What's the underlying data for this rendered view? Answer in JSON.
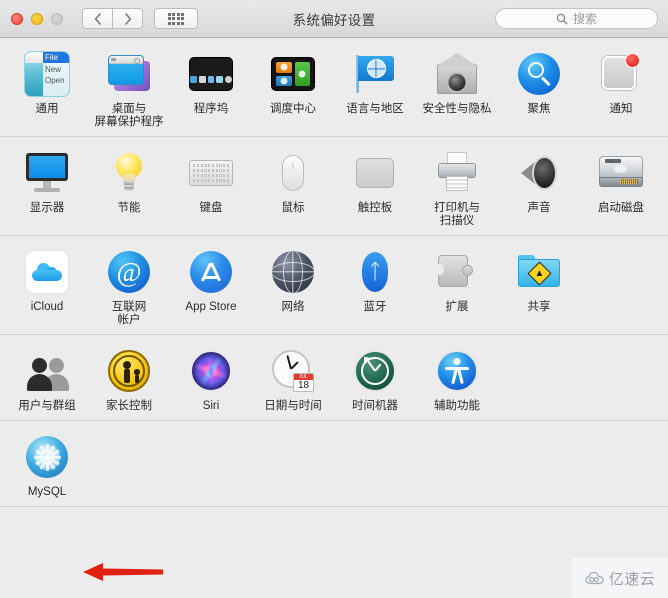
{
  "window": {
    "title": "系统偏好设置",
    "traffic_lights": [
      "close",
      "minimize",
      "zoom"
    ],
    "nav": {
      "back_label": "‹",
      "forward_label": "›"
    },
    "show_all_label": "显示全部"
  },
  "search": {
    "placeholder": "搜索",
    "value": ""
  },
  "rows": [
    {
      "items": [
        {
          "label": "通用",
          "icon": "general-icon",
          "art": "general",
          "general": {
            "menu_title": "File",
            "menu_items": [
              "New",
              "Open"
            ]
          }
        },
        {
          "label": "桌面与\n屏幕保护程序",
          "icon": "desktop-screensaver-icon",
          "art": "desktop"
        },
        {
          "label": "程序坞",
          "icon": "dock-icon",
          "art": "dock"
        },
        {
          "label": "调度中心",
          "icon": "mission-control-icon",
          "art": "mission"
        },
        {
          "label": "语言与地区",
          "icon": "language-region-icon",
          "art": "flag"
        },
        {
          "label": "安全性与隐私",
          "icon": "security-privacy-icon",
          "art": "security"
        },
        {
          "label": "聚焦",
          "icon": "spotlight-icon",
          "art": "spotlight"
        },
        {
          "label": "通知",
          "icon": "notifications-icon",
          "art": "notify",
          "badge": true
        }
      ]
    },
    {
      "items": [
        {
          "label": "显示器",
          "icon": "displays-icon",
          "art": "display"
        },
        {
          "label": "节能",
          "icon": "energy-saver-icon",
          "art": "bulb"
        },
        {
          "label": "键盘",
          "icon": "keyboard-icon",
          "art": "keyboard"
        },
        {
          "label": "鼠标",
          "icon": "mouse-icon",
          "art": "mouse"
        },
        {
          "label": "触控板",
          "icon": "trackpad-icon",
          "art": "trackpad"
        },
        {
          "label": "打印机与\n扫描仪",
          "icon": "printers-scanners-icon",
          "art": "printer"
        },
        {
          "label": "声音",
          "icon": "sound-icon",
          "art": "sound"
        },
        {
          "label": "启动磁盘",
          "icon": "startup-disk-icon",
          "art": "disk"
        }
      ]
    },
    {
      "items": [
        {
          "label": "iCloud",
          "icon": "icloud-icon",
          "art": "icloud"
        },
        {
          "label": "互联网\n帐户",
          "icon": "internet-accounts-icon",
          "art": "at"
        },
        {
          "label": "App Store",
          "icon": "app-store-icon",
          "art": "appstore"
        },
        {
          "label": "网络",
          "icon": "network-icon",
          "art": "network"
        },
        {
          "label": "蓝牙",
          "icon": "bluetooth-icon",
          "art": "bluetooth"
        },
        {
          "label": "扩展",
          "icon": "extensions-icon",
          "art": "extension"
        },
        {
          "label": "共享",
          "icon": "sharing-icon",
          "art": "sharing"
        }
      ]
    },
    {
      "items": [
        {
          "label": "用户与群组",
          "icon": "users-groups-icon",
          "art": "users"
        },
        {
          "label": "家长控制",
          "icon": "parental-controls-icon",
          "art": "parental"
        },
        {
          "label": "Siri",
          "icon": "siri-icon",
          "art": "siri"
        },
        {
          "label": "日期与时间",
          "icon": "date-time-icon",
          "art": "clock",
          "calendar": {
            "month": "JUL",
            "day": "18"
          }
        },
        {
          "label": "时间机器",
          "icon": "time-machine-icon",
          "art": "timemachine"
        },
        {
          "label": "辅助功能",
          "icon": "accessibility-icon",
          "art": "accessibility"
        }
      ]
    },
    {
      "items": [
        {
          "label": "MySQL",
          "icon": "mysql-icon",
          "art": "mysql"
        }
      ]
    }
  ],
  "annotation": {
    "arrow_color": "#e02010",
    "points_to": "MySQL"
  },
  "watermark": {
    "text": "亿速云",
    "logo": "cloud-icon"
  },
  "colors": {
    "window_bg": "#ececec",
    "titlebar_bg": "#e3e3e3",
    "separator": "#d2d2d2",
    "label_text": "#2a2a2a",
    "badge_red": "#e01b0e"
  }
}
